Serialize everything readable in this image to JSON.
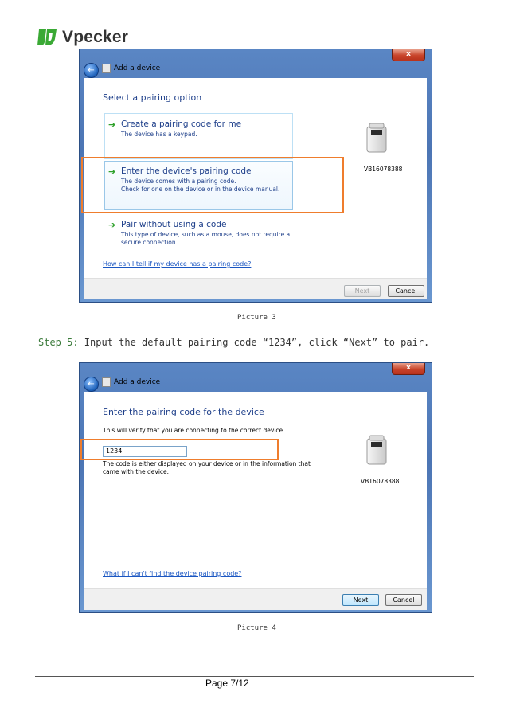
{
  "brand": {
    "name": "Vpecker",
    "color": "#3aa935"
  },
  "dialog1": {
    "title": "Add a device",
    "close_glyph": "x",
    "back_glyph": "←",
    "heading": "Select a pairing option",
    "options": [
      {
        "title": "Create a pairing code for me",
        "desc1": "The device has a keypad.",
        "desc2": ""
      },
      {
        "title": "Enter the device's pairing code",
        "desc1": "The device comes with a pairing code.",
        "desc2": "Check for one on the device or in the device manual."
      },
      {
        "title": "Pair without using a code",
        "desc1": "This type of device, such as a mouse, does not require a",
        "desc2": "secure connection."
      }
    ],
    "help_link": "How can I tell if my device has a pairing code?",
    "device_name": "VB16078388",
    "next_label": "Next",
    "cancel_label": "Cancel"
  },
  "caption1": "Picture 3",
  "step": {
    "label": "Step 5:",
    "text": " Input the default pairing code “1234”, click “Next” to pair."
  },
  "dialog2": {
    "title": "Add a device",
    "close_glyph": "x",
    "back_glyph": "←",
    "heading": "Enter the pairing code for the device",
    "intro": "This will verify that you are connecting to the correct device.",
    "code_value": "1234",
    "note1": "The code is either displayed on your device or in the information that",
    "note2": "came with the device.",
    "help_link": "What if I can't find the device pairing code?",
    "device_name": "VB16078388",
    "next_label": "Next",
    "cancel_label": "Cancel"
  },
  "caption2": "Picture 4",
  "footer": {
    "page": "Page 7/12"
  },
  "colors": {
    "highlight": "#ef7d2d",
    "heading": "#1e3f8a",
    "link": "#1a56c2",
    "arrow": "#2fa12b"
  }
}
